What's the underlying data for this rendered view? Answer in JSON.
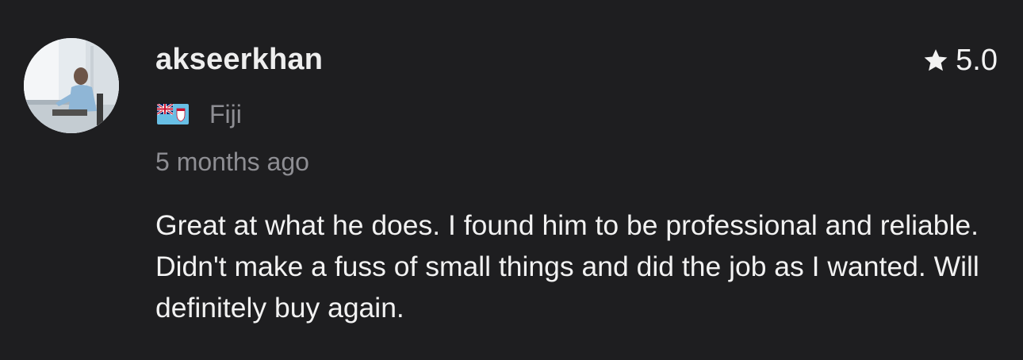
{
  "review": {
    "username": "akseerkhan",
    "rating": "5.0",
    "country": "Fiji",
    "time": "5 months ago",
    "text": "Great at what he does. I found him to be professional and reliable. Didn't make a fuss of small things and did the job as I wanted. Will definitely buy again.",
    "rating_icon": "star-icon",
    "country_icon": "fiji-flag-icon",
    "colors": {
      "background": "#1e1e20",
      "primary_text": "#f2f2f2",
      "secondary_text": "#8e8e93"
    }
  }
}
